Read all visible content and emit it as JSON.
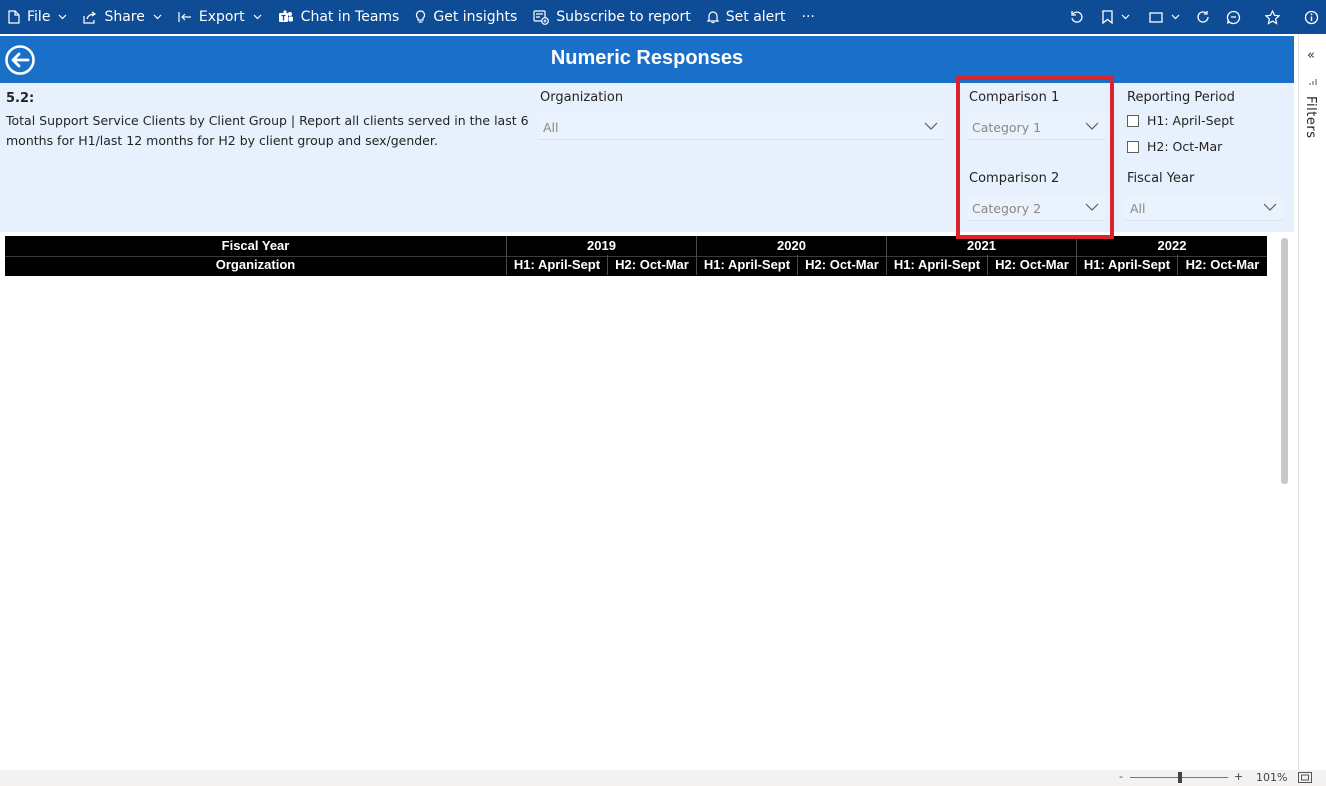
{
  "toolbar": {
    "file": "File",
    "share": "Share",
    "export": "Export",
    "chat_in_teams": "Chat in Teams",
    "get_insights": "Get insights",
    "subscribe": "Subscribe to report",
    "set_alert": "Set alert",
    "more": "···"
  },
  "report": {
    "title": "Numeric Responses",
    "question_number": "5.2:",
    "question_text": "Total Support Service Clients by Client Group | Report all clients served in the last 6 months for H1/last 12 months for H2 by client group and sex/gender."
  },
  "slicers": {
    "organization": {
      "label": "Organization",
      "value": "All"
    },
    "comparison1": {
      "label": "Comparison 1",
      "value": "Category 1"
    },
    "comparison2": {
      "label": "Comparison 2",
      "value": "Category 2"
    },
    "reporting_period": {
      "label": "Reporting Period",
      "options": [
        "H1: April-Sept",
        "H2: Oct-Mar"
      ]
    },
    "fiscal_year": {
      "label": "Fiscal Year",
      "value": "All"
    }
  },
  "matrix": {
    "row_header_1": "Fiscal Year",
    "row_header_2": "Organization",
    "years": [
      "2019",
      "2020",
      "2021",
      "2022"
    ],
    "periods": [
      "H1: April-Sept",
      "H2: Oct-Mar"
    ]
  },
  "filters_pane": {
    "label": "Filters"
  },
  "status": {
    "zoom_minus": "-",
    "zoom_plus": "+",
    "zoom": "101%"
  },
  "colors": {
    "topbar": "#0f4c96",
    "title_bar": "#1a6fc9",
    "slicer_bg": "#e6f1fd",
    "highlight": "#d9232d"
  }
}
